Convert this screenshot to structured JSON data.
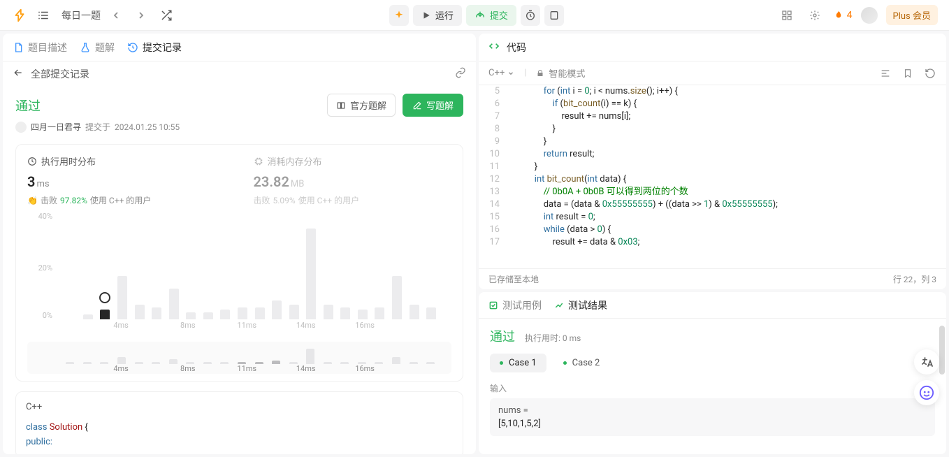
{
  "topbar": {
    "daily_label": "每日一题",
    "run_label": "运行",
    "submit_label": "提交",
    "fire_count": "4",
    "plus_label": "Plus 会员"
  },
  "left": {
    "tabs": {
      "desc": "题目描述",
      "sol": "题解",
      "subs": "提交记录"
    },
    "subbar": {
      "back": "全部提交记录"
    },
    "status": "通过",
    "official": "官方题解",
    "write": "写题解",
    "meta": {
      "user": "四月一日君寻",
      "submitted_prefix": "提交于",
      "time": "2024.01.25 10:55"
    },
    "stats": {
      "runtime_title": "执行用时分布",
      "runtime_value": "3",
      "runtime_unit": "ms",
      "runtime_beat_prefix": "击败",
      "runtime_beat_pct": "97.82%",
      "runtime_beat_suffix": "使用 C++ 的用户",
      "memory_title": "消耗内存分布",
      "memory_value": "23.82",
      "memory_unit": "MB",
      "memory_beat_prefix": "击败",
      "memory_beat_pct": "5.09%",
      "memory_beat_suffix": "使用 C++ 的用户"
    },
    "chart": {
      "y40": "40%",
      "y20": "20%",
      "y0": "0%",
      "x4": "4ms",
      "x8": "8ms",
      "x11": "11ms",
      "x14": "14ms",
      "x16": "16ms"
    },
    "code_lang": "C++",
    "code_line1_a": "class",
    "code_line1_b": "Solution",
    "code_line1_c": " {",
    "code_line2": "public:"
  },
  "right": {
    "code_title": "代码",
    "lang": "C++",
    "smart_mode": "智能模式",
    "lines": [
      {
        "n": "5",
        "indent": 3,
        "seg": [
          {
            "c": "tok-kw",
            "t": "for"
          },
          {
            "t": " ("
          },
          {
            "c": "tok-kw",
            "t": "int"
          },
          {
            "t": " i = "
          },
          {
            "c": "tok-num",
            "t": "0"
          },
          {
            "t": "; i < nums."
          },
          {
            "c": "tok-fn",
            "t": "size"
          },
          {
            "t": "(); i++) {"
          }
        ]
      },
      {
        "n": "6",
        "indent": 4,
        "seg": [
          {
            "c": "tok-kw",
            "t": "if"
          },
          {
            "t": " ("
          },
          {
            "c": "tok-fn",
            "t": "bit_count"
          },
          {
            "t": "(i) == k) {"
          }
        ]
      },
      {
        "n": "7",
        "indent": 5,
        "seg": [
          {
            "t": "result += nums[i];"
          }
        ]
      },
      {
        "n": "8",
        "indent": 4,
        "seg": [
          {
            "t": "}"
          }
        ]
      },
      {
        "n": "9",
        "indent": 3,
        "seg": [
          {
            "t": "}"
          }
        ]
      },
      {
        "n": "10",
        "indent": 3,
        "seg": [
          {
            "c": "tok-kw",
            "t": "return"
          },
          {
            "t": " result;"
          }
        ]
      },
      {
        "n": "11",
        "indent": 2,
        "seg": [
          {
            "t": "}"
          }
        ]
      },
      {
        "n": "12",
        "indent": 2,
        "seg": [
          {
            "c": "tok-kw",
            "t": "int"
          },
          {
            "t": " "
          },
          {
            "c": "tok-fn",
            "t": "bit_count"
          },
          {
            "t": "("
          },
          {
            "c": "tok-kw",
            "t": "int"
          },
          {
            "t": " data) {"
          }
        ]
      },
      {
        "n": "13",
        "indent": 3,
        "seg": [
          {
            "c": "tok-cm",
            "t": "// 0b0A + 0b0B 可以得到两位的个数"
          }
        ]
      },
      {
        "n": "14",
        "indent": 3,
        "seg": [
          {
            "t": "data = (data & "
          },
          {
            "c": "tok-num",
            "t": "0x55555555"
          },
          {
            "t": ") + ((data >> "
          },
          {
            "c": "tok-num",
            "t": "1"
          },
          {
            "t": ") & "
          },
          {
            "c": "tok-num",
            "t": "0x55555555"
          },
          {
            "t": ");"
          }
        ]
      },
      {
        "n": "15",
        "indent": 3,
        "seg": [
          {
            "c": "tok-kw",
            "t": "int"
          },
          {
            "t": " result = "
          },
          {
            "c": "tok-num",
            "t": "0"
          },
          {
            "t": ";"
          }
        ]
      },
      {
        "n": "16",
        "indent": 3,
        "seg": [
          {
            "c": "tok-kw",
            "t": "while"
          },
          {
            "t": " (data > "
          },
          {
            "c": "tok-num",
            "t": "0"
          },
          {
            "t": ") {"
          }
        ]
      },
      {
        "n": "17",
        "indent": 4,
        "seg": [
          {
            "t": "result += data & "
          },
          {
            "c": "tok-num",
            "t": "0x03"
          },
          {
            "t": ";"
          }
        ]
      }
    ],
    "foot_left": "已存储至本地",
    "foot_right": "行 22，列 3",
    "result": {
      "tab_cases": "测试用例",
      "tab_results": "测试结果",
      "pass": "通过",
      "time": "执行用时: 0 ms",
      "case1": "Case 1",
      "case2": "Case 2",
      "input_label": "输入",
      "input_var": "nums =",
      "input_val": "[5,10,1,5,2]"
    }
  },
  "chart_data": {
    "type": "bar",
    "title": "执行用时分布",
    "xlabel": "ms",
    "ylabel": "%",
    "ylim": [
      0,
      45
    ],
    "categories": [
      1,
      2,
      3,
      4,
      5,
      6,
      7,
      8,
      9,
      10,
      11,
      12,
      13,
      14,
      15,
      16,
      17,
      18,
      19,
      20,
      21,
      22
    ],
    "values": [
      0,
      2,
      4,
      18,
      6,
      5,
      13,
      3,
      3,
      4,
      5,
      5,
      8,
      6,
      38,
      6,
      5,
      4,
      5,
      18,
      6,
      5
    ],
    "highlight_index": 2
  }
}
